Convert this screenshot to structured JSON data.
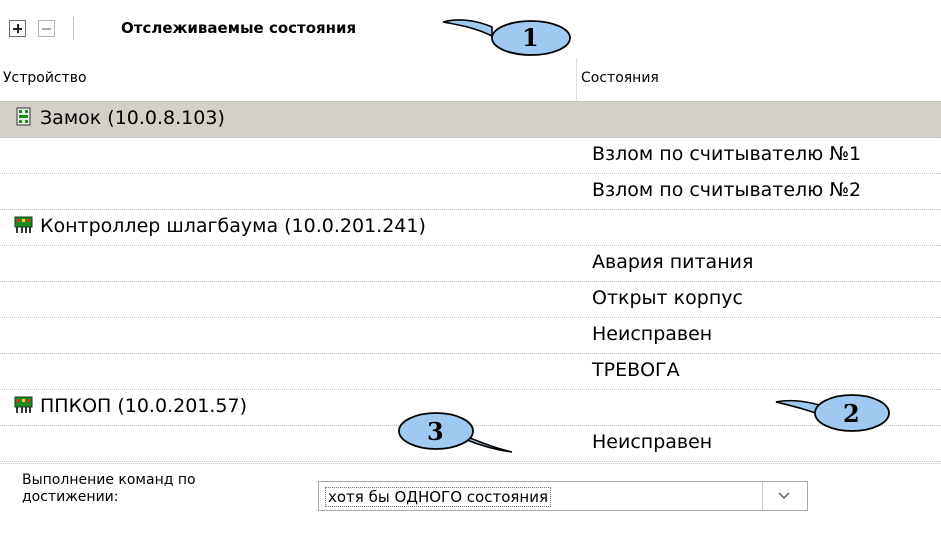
{
  "toolbar": {
    "add_icon": "add-icon",
    "remove_icon": "remove-icon",
    "title": "Отслеживаемые состояния"
  },
  "columns": {
    "device": "Устройство",
    "states": "Состояния"
  },
  "rows": [
    {
      "device": "Замок (10.0.8.103)",
      "state": "",
      "icon": "lock-device-icon",
      "selected": true
    },
    {
      "device": "",
      "state": "Взлом по считывателю №1"
    },
    {
      "device": "",
      "state": "Взлом по считывателю №2"
    },
    {
      "device": "Контроллер шлагбаума (10.0.201.241)",
      "state": "",
      "icon": "controller-device-icon"
    },
    {
      "device": "",
      "state": "Авария питания"
    },
    {
      "device": "",
      "state": "Открыт корпус"
    },
    {
      "device": "",
      "state": "Неисправен"
    },
    {
      "device": "",
      "state": "ТРЕВОГА"
    },
    {
      "device": "ППКОП (10.0.201.57)",
      "state": "",
      "icon": "panel-device-icon"
    },
    {
      "device": "",
      "state": "Неисправен"
    }
  ],
  "command": {
    "label": "Выполнение команд по достижении:",
    "selected": "хотя бы ОДНОГО состояния",
    "arrow_icon": "chevron-down-icon"
  },
  "callouts": [
    "1",
    "2",
    "3"
  ],
  "colors": {
    "callout_fill": "#9fc9f0",
    "selected_row": "#d4d0c8",
    "icon_green": "#1f8a1f"
  }
}
